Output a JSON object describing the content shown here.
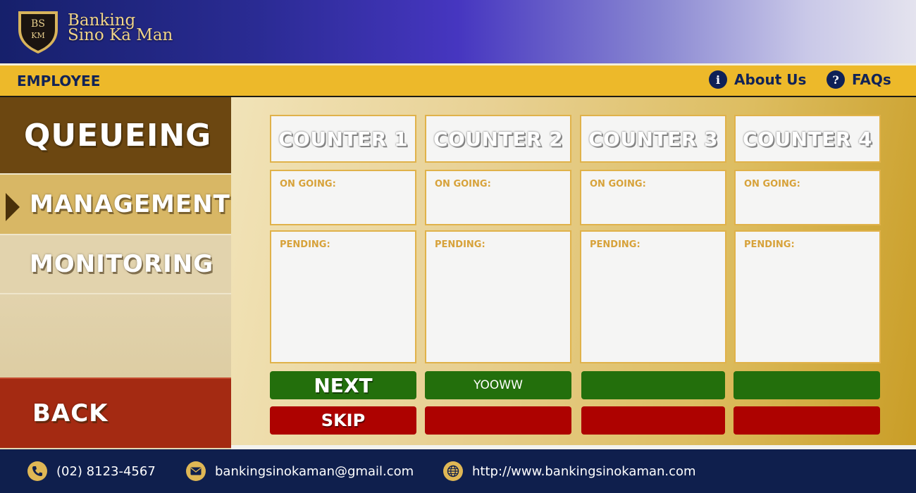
{
  "header": {
    "logo_text_top": "BS",
    "logo_text_bottom": "KM",
    "brand_line1": "Banking",
    "brand_line2": "Sino Ka Man"
  },
  "subbar": {
    "title": "EMPLOYEE",
    "about_label": "About Us",
    "faqs_label": "FAQs",
    "about_icon": "info-icon",
    "faqs_icon": "question-icon"
  },
  "sidebar": {
    "queueing": "QUEUEING",
    "management": "MANAGEMENT",
    "monitoring": "MONITORING",
    "back": "BACK"
  },
  "counters": [
    {
      "title": "COUNTER 1",
      "ongoing_label": "ON GOING:",
      "pending_label": "PENDING:",
      "next_label": "NEXT",
      "skip_label": "SKIP"
    },
    {
      "title": "COUNTER 2",
      "ongoing_label": "ON GOING:",
      "pending_label": "PENDING:",
      "next_label": "YOOWW",
      "skip_label": ""
    },
    {
      "title": "COUNTER 3",
      "ongoing_label": "ON GOING:",
      "pending_label": "PENDING:",
      "next_label": "",
      "skip_label": ""
    },
    {
      "title": "COUNTER 4",
      "ongoing_label": "ON GOING:",
      "pending_label": "PENDING:",
      "next_label": "",
      "skip_label": ""
    }
  ],
  "footer": {
    "phone": "(02) 8123-4567",
    "email": "bankingsinokaman@gmail.com",
    "website": "http://www.bankingsinokaman.com"
  },
  "colors": {
    "navy": "#0f1f4d",
    "gold": "#edb92a",
    "next_green": "#236f0c",
    "skip_red": "#ad0200",
    "back_red": "#a42a12"
  }
}
